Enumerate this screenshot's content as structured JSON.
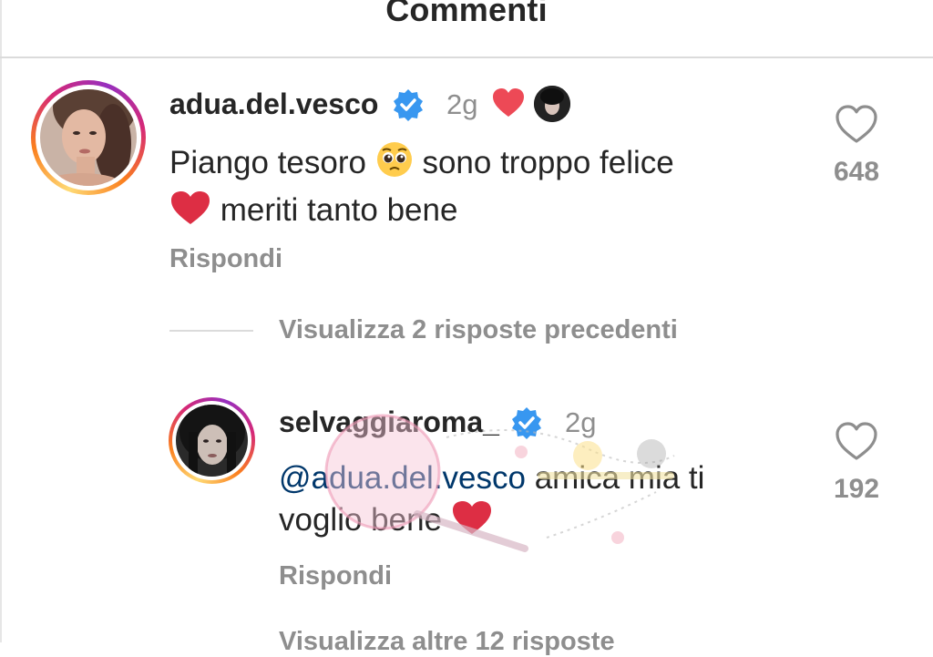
{
  "header": {
    "title": "Commenti"
  },
  "comments": [
    {
      "username": "adua.del.vesco",
      "time": "2g",
      "text_line1_a": "Piango tesoro",
      "text_line1_b": "sono troppo felice",
      "text_line2": "meriti tanto bene",
      "reply_label": "Rispondi",
      "likes": "648",
      "icons": [
        "avatar-photo",
        "verified-badge-icon",
        "red-heart-icon",
        "liker-avatar",
        "pleading-face-emoji",
        "heart-outline-icon"
      ]
    },
    {
      "username": "selvaggiaroma_",
      "time": "2g",
      "mention": "@adua.del.vesco",
      "text_line1": "amica mia ti",
      "text_line2": "voglio bene",
      "reply_label": "Rispondi",
      "likes": "192",
      "icons": [
        "avatar-photo",
        "verified-badge-icon",
        "red-heart-emoji",
        "heart-outline-icon"
      ]
    }
  ],
  "view_previous_replies": "Visualizza 2 risposte precedenti",
  "view_more_replies": "Visualizza altre 12 risposte",
  "colors": {
    "text": "#262626",
    "secondary": "#8e8e8e",
    "verified": "#3897f0",
    "heart": "#ed4956",
    "mention": "#00376b",
    "divider": "#dbdbdb"
  }
}
